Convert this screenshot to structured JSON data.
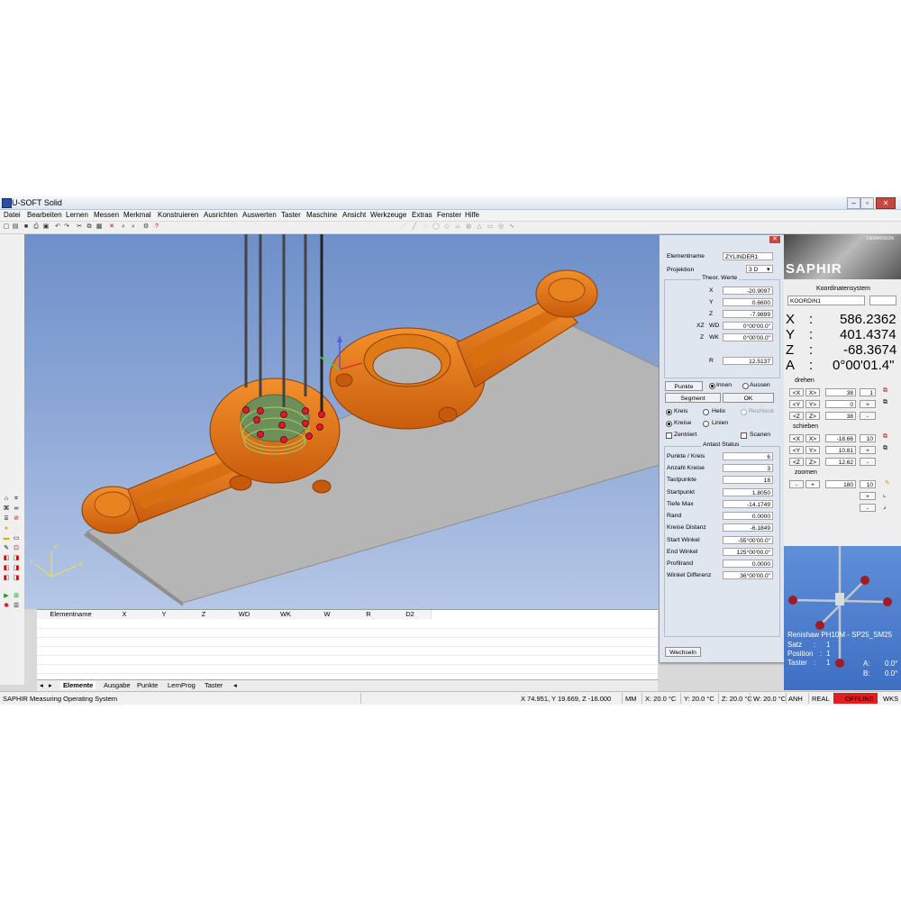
{
  "window": {
    "title": "U-SOFT Solid"
  },
  "menu": [
    "Datei",
    "Bearbeiten",
    "Lernen",
    "Messen",
    "Merkmal",
    "Konstruieren",
    "Ausrichten",
    "Auswerten",
    "Taster",
    "Maschine",
    "Ansicht",
    "Werkzeuge",
    "Extras",
    "Fenster",
    "Hilfe"
  ],
  "dialog": {
    "elementname_label": "Elementname",
    "elementname_value": "ZYLINDER1",
    "projektion_label": "Projektion",
    "projektion_value": "3 D",
    "theor_title": "Theor. Werte",
    "x_label": "X",
    "x_value": "-20.9097",
    "y_label": "Y",
    "y_value": "0.6600",
    "z_label": "Z",
    "z_value": "-7.9899",
    "xz_label": "XZ",
    "wd_label": "WD",
    "wd_value": "0°00'00.0\"",
    "z2_label": "Z",
    "wk_label": "WK",
    "wk_value": "0°00'00.0\"",
    "r_label": "R",
    "r_value": "12.5137",
    "punkte_button": "Punkte",
    "innen_label": "Innen",
    "aussen_label": "Aussen",
    "segment_button": "Segment",
    "ok_button": "OK",
    "kreis_label": "Kreis",
    "helix_label": "Helix",
    "rechteck_label": "Rechteck",
    "kreise_label": "Kreise",
    "linien_label": "Linien",
    "zentriert_label": "Zentriert",
    "scanen_label": "Scanen",
    "antast_title": "Antast Status",
    "rows": [
      {
        "label": "Punkte / Kreis",
        "value": "6"
      },
      {
        "label": "Anzahl Kreise",
        "value": "3"
      },
      {
        "label": "Tastpunkte",
        "value": "18"
      },
      {
        "label": "Startpunkt",
        "value": "1.8050"
      },
      {
        "label": "Tiefe Max",
        "value": "-14.1749"
      },
      {
        "label": "Rand",
        "value": "0.0000"
      },
      {
        "label": "Kreise Distanz",
        "value": "-6.1849"
      },
      {
        "label": "Start Winkel",
        "value": "-55°00'00.0\""
      },
      {
        "label": "End Winkel",
        "value": "125°00'00.0\""
      },
      {
        "label": "Profilrand",
        "value": "0.0000"
      },
      {
        "label": "Winkel Differenz",
        "value": "36°00'00.0\""
      }
    ],
    "wechseln_button": "Wechseln"
  },
  "right": {
    "logo": "SAPHIR",
    "logo_small": "DERMOGON",
    "koord_title": "Koordinatensystem",
    "koord_value": "KOORDIN1",
    "readouts": [
      {
        "axis": "X",
        "sep": ":",
        "value": "586.2362"
      },
      {
        "axis": "Y",
        "sep": ":",
        "value": "401.4374"
      },
      {
        "axis": "Z",
        "sep": ":",
        "value": "-68.3674"
      },
      {
        "axis": "A",
        "sep": ":",
        "value": "0°00'01.4\""
      }
    ],
    "drehen_label": "drehen",
    "drehen_rows": [
      {
        "a": "<X",
        "b": "X>",
        "v1": "38",
        "v2": "1"
      },
      {
        "a": "<Y",
        "b": "Y>",
        "v1": "0",
        "v2": "+"
      },
      {
        "a": "<Z",
        "b": "Z>",
        "v1": "38",
        "v2": "-"
      }
    ],
    "schieben_label": "schieben",
    "schieben_rows": [
      {
        "a": "<X",
        "b": "X>",
        "v1": "-18.66",
        "v2": "10"
      },
      {
        "a": "<Y",
        "b": "Y>",
        "v1": "10.81",
        "v2": "+"
      },
      {
        "a": "<Z",
        "b": "Z>",
        "v1": "12.62",
        "v2": "-"
      }
    ],
    "zoomen_label": "zoomen",
    "zoom_minus": "-",
    "zoom_plus": "+",
    "zoom_v1": "180",
    "zoom_v2": "10",
    "zoom_b1": "+",
    "zoom_b2": "-",
    "probe_title": "Renishaw PH10M - SP25_SM25",
    "satz_label": "Satz",
    "satz_sep": ":",
    "satz_value": "1",
    "position_label": "Position",
    "position_sep": ":",
    "position_value": "1",
    "taster_label": "Taster",
    "taster_sep": ":",
    "taster_value": "1",
    "a_label": "A:",
    "a_value": "0.0°",
    "b_label": "B:",
    "b_value": "0.0°"
  },
  "table": {
    "columns": [
      "Elementname",
      "X",
      "Y",
      "Z",
      "WD",
      "WK",
      "W",
      "R",
      "D2"
    ]
  },
  "tabs": [
    "Elemente",
    "Ausgabe",
    "Punkte",
    "LernProg",
    "Taster"
  ],
  "status": {
    "app": "SAPHIR Measuring Operating System",
    "coords": "X 74.951, Y 19.669, Z -16.000",
    "unit": "MM",
    "tx": "X: 20.0 °C",
    "ty": "Y: 20.0 °C",
    "tz": "Z: 20.0 °C",
    "tw": "W: 20.0 °C",
    "anh": "ANH",
    "real": "REAL",
    "offline": "OFFLINE",
    "wks": "WKS"
  },
  "colors": {
    "part": "#e8761a",
    "viewport_top": "#6e8fc9",
    "offline": "#e02020",
    "probe_ball": "#a01c24"
  }
}
